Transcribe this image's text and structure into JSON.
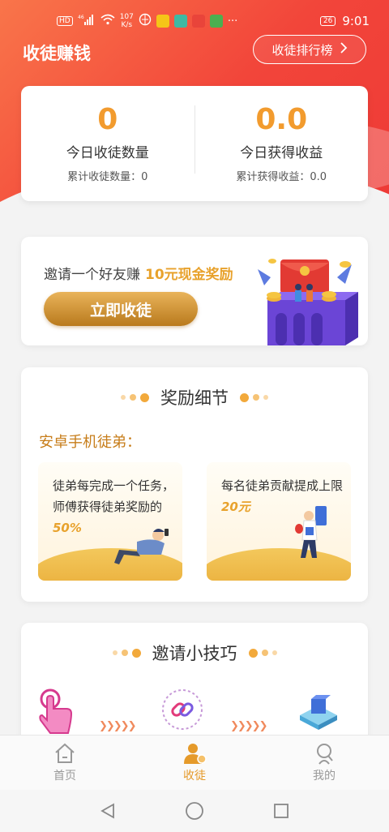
{
  "status_bar": {
    "sim_badge": "HD",
    "signal": "46",
    "net_speed_value": "107",
    "net_speed_unit": "K/s",
    "battery": "26",
    "time": "9:01",
    "more": "···"
  },
  "header": {
    "title": "收徒赚钱",
    "rank_button": "收徒排行榜"
  },
  "stats": {
    "today_disciples_value": "0",
    "today_disciples_label": "今日收徒数量",
    "total_disciples": "累计收徒数量：0",
    "today_income_value": "0.0",
    "today_income_label": "今日获得收益",
    "total_income": "累计获得收益：0.0"
  },
  "invite": {
    "text": "邀请一个好友赚",
    "highlight": "10元现金奖励",
    "button": "立即收徒"
  },
  "reward": {
    "title": "奖励细节",
    "subtitle": "安卓手机徒弟：",
    "tile1_text": "徒弟每完成一个任务，师傅获得徒弟奖励的",
    "tile1_percent": "50%",
    "tile2_text": "每名徒弟贡献提成上限",
    "tile2_amount": "20元"
  },
  "tips": {
    "title": "邀请小技巧"
  },
  "tabs": [
    {
      "label": "首页",
      "icon": "home-icon"
    },
    {
      "label": "收徒",
      "icon": "disciple-icon"
    },
    {
      "label": "我的",
      "icon": "profile-icon"
    }
  ],
  "colors": {
    "brand_red": "#f2453a",
    "accent_gold": "#e59a2a",
    "highlight": "#e8a22c"
  }
}
